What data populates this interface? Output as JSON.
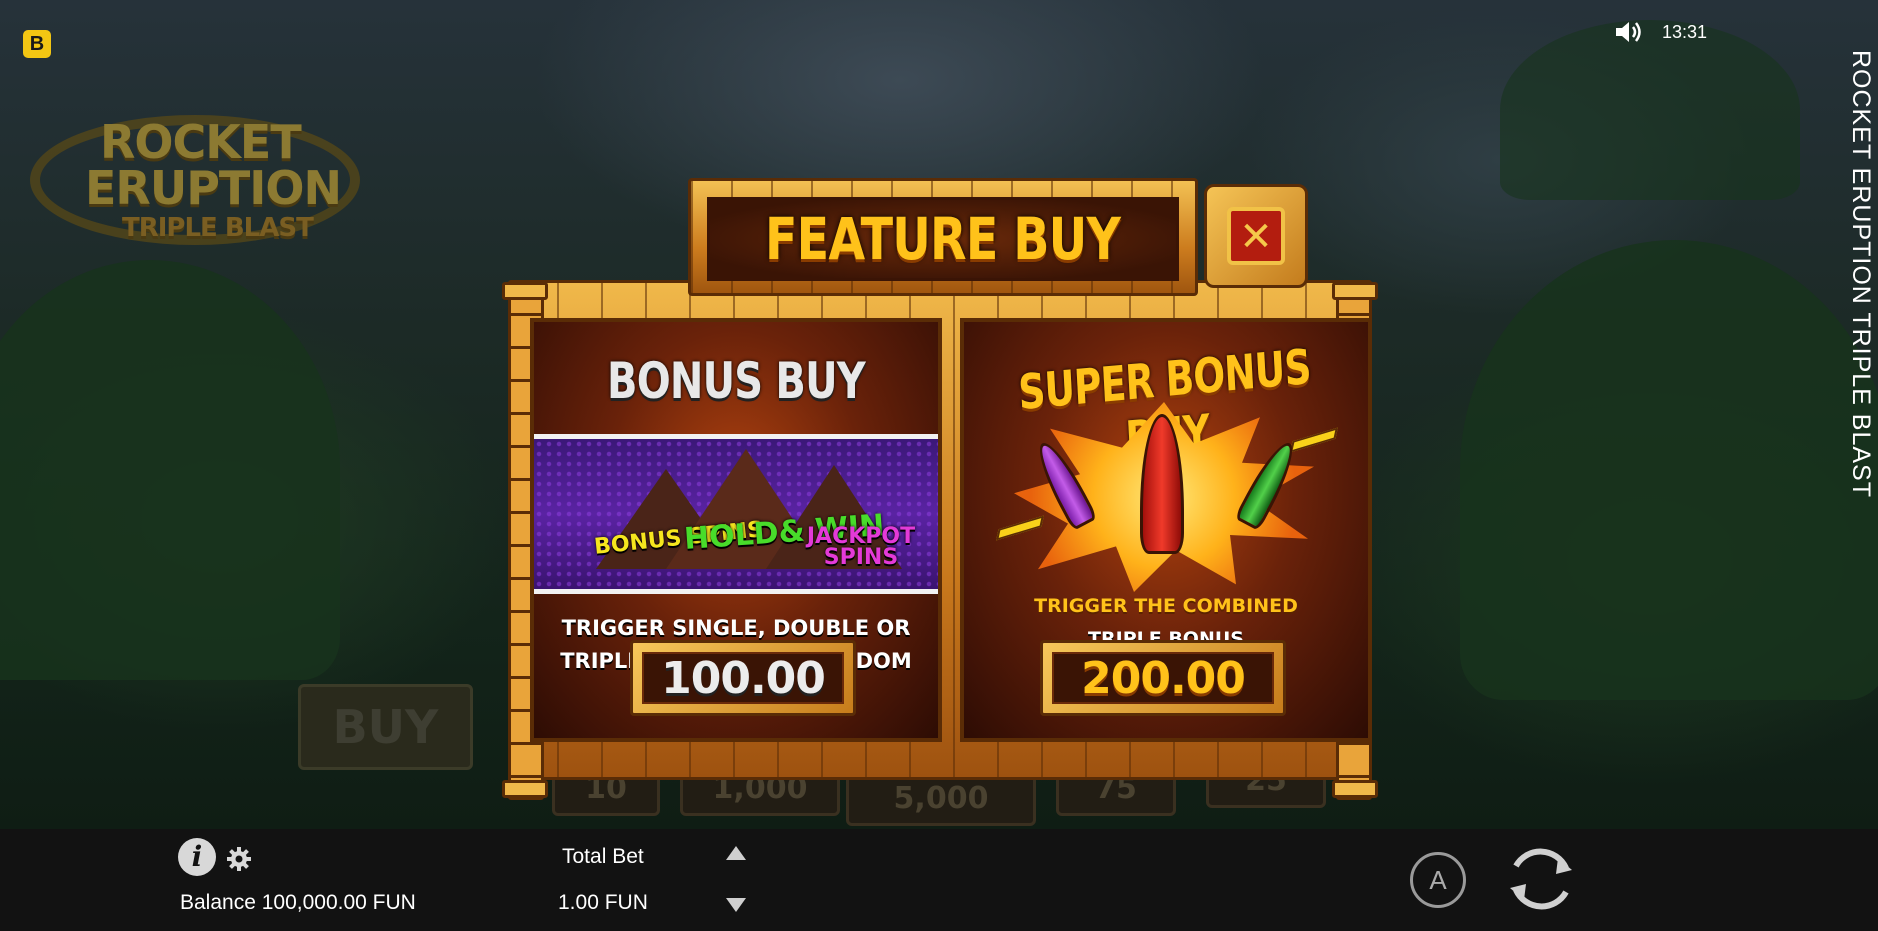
{
  "app": {
    "brand_badge": "B",
    "logo_line1": "ROCKET",
    "logo_line2": "ERUPTION",
    "logo_line3": "TRIPLE BLAST",
    "side_title": "ROCKET ERUPTION TRIPLE BLAST",
    "clock": "13:31",
    "background_buy_label": "BUY",
    "reel_values": [
      "10",
      "1,000",
      "5,000",
      "75",
      "25"
    ]
  },
  "modal": {
    "title": "FEATURE BUY",
    "close_icon": "close-icon",
    "bonus_buy": {
      "title": "BONUS BUY",
      "tag_bonus": "BONUS SPINS",
      "tag_hold": "HOLD& WIN",
      "tag_jackpot": "JACKPOT SPINS",
      "desc_line1": "TRIGGER SINGLE, DOUBLE OR",
      "desc_line2": "TRIPLE BONUSES AT RANDOM",
      "price": "100.00"
    },
    "super_bonus_buy": {
      "title": "SUPER BONUS BUY",
      "desc_line1": "TRIGGER THE COMBINED",
      "desc_line2": "TRIPLE BONUS",
      "price": "200.00"
    }
  },
  "bottom_bar": {
    "balance": "Balance 100,000.00 FUN",
    "total_bet_label": "Total Bet",
    "total_bet_value": "1.00 FUN",
    "auto_label": "A",
    "icons": [
      "info-icon",
      "gear-icon",
      "bet-up-icon",
      "bet-down-icon",
      "autoplay-icon",
      "spin-icon"
    ]
  },
  "colors": {
    "accent_gold": "#ffc21a",
    "frame_brown": "#5a2c06",
    "bottom_bar": "#121212",
    "badge_yellow": "#f3c613"
  }
}
